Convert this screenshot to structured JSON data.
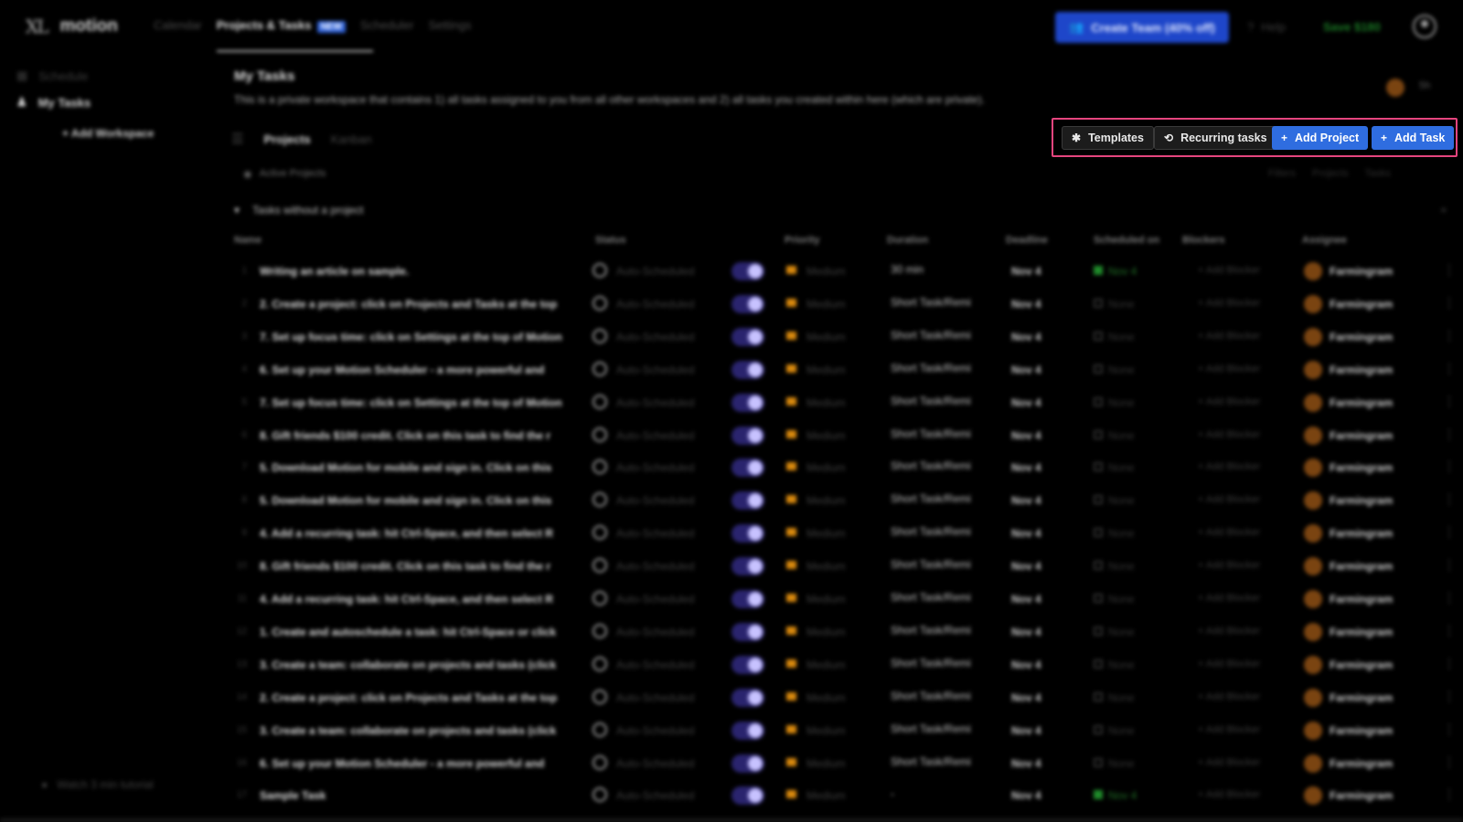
{
  "app": {
    "logo_mark": "XL",
    "name": "motion"
  },
  "topnav": {
    "items": [
      "Calendar",
      "Projects & Tasks",
      "Scheduler",
      "Settings"
    ],
    "new_badge": "NEW",
    "create_team": "Create Team (40% off)",
    "help": "Help",
    "save": "Save $180"
  },
  "sidebar": {
    "schedule": "Schedule",
    "my_tasks": "My Tasks",
    "add_workspace": "+ Add Workspace",
    "tutorial": "Watch 3 min tutorial"
  },
  "page": {
    "title": "My Tasks",
    "description": "This is a private workspace that contains 1) all tasks assigned to you from all other workspaces and 2) all tasks you created within here (which are private).",
    "header_more": "5h"
  },
  "view_tabs": [
    "Projects",
    "Kanban"
  ],
  "toolbar": {
    "templates": "Templates",
    "recurring": "Recurring tasks",
    "add_project": "Add Project",
    "add_task": "Add Task"
  },
  "filters": {
    "active_projects": "Active Projects",
    "filters": "Filters",
    "projects": "Projects",
    "tasks": "Tasks"
  },
  "group": {
    "label": "Tasks without a project"
  },
  "columns": {
    "name": "Name",
    "status": "Status",
    "priority": "Priority",
    "duration": "Duration",
    "deadline": "Deadline",
    "scheduled_on": "Scheduled on",
    "blockers": "Blockers",
    "assignee": "Assignee"
  },
  "rows": [
    {
      "num": "1",
      "name": "Writing an article on sample.",
      "status": "Auto-Scheduled",
      "priority": "Medium",
      "duration": "30 min",
      "deadline": "Nov 4",
      "scheduled": "Nov 4",
      "sched_green": true,
      "blocker": "+ Add Blocker",
      "assignee": "Farmingram"
    },
    {
      "num": "2",
      "name": "2. Create a project: click on Projects and Tasks at the top",
      "status": "Auto-Scheduled",
      "priority": "Medium",
      "duration": "Short Task/Remi",
      "deadline": "Nov 4",
      "scheduled": "None",
      "sched_green": false,
      "blocker": "+ Add Blocker",
      "assignee": "Farmingram"
    },
    {
      "num": "3",
      "name": "7. Set up focus time: click on Settings at the top of Motion",
      "status": "Auto-Scheduled",
      "priority": "Medium",
      "duration": "Short Task/Remi",
      "deadline": "Nov 4",
      "scheduled": "None",
      "sched_green": false,
      "blocker": "+ Add Blocker",
      "assignee": "Farmingram"
    },
    {
      "num": "4",
      "name": "6. Set up your Motion Scheduler - a more powerful and",
      "status": "Auto-Scheduled",
      "priority": "Medium",
      "duration": "Short Task/Remi",
      "deadline": "Nov 4",
      "scheduled": "None",
      "sched_green": false,
      "blocker": "+ Add Blocker",
      "assignee": "Farmingram"
    },
    {
      "num": "5",
      "name": "7. Set up focus time: click on Settings at the top of Motion",
      "status": "Auto-Scheduled",
      "priority": "Medium",
      "duration": "Short Task/Remi",
      "deadline": "Nov 4",
      "scheduled": "None",
      "sched_green": false,
      "blocker": "+ Add Blocker",
      "assignee": "Farmingram"
    },
    {
      "num": "6",
      "name": "8. Gift friends $100 credit. Click on this task to find the r",
      "status": "Auto-Scheduled",
      "priority": "Medium",
      "duration": "Short Task/Remi",
      "deadline": "Nov 4",
      "scheduled": "None",
      "sched_green": false,
      "blocker": "+ Add Blocker",
      "assignee": "Farmingram"
    },
    {
      "num": "7",
      "name": "5. Download Motion for mobile and sign in. Click on this",
      "status": "Auto-Scheduled",
      "priority": "Medium",
      "duration": "Short Task/Remi",
      "deadline": "Nov 4",
      "scheduled": "None",
      "sched_green": false,
      "blocker": "+ Add Blocker",
      "assignee": "Farmingram"
    },
    {
      "num": "8",
      "name": "5. Download Motion for mobile and sign in. Click on this",
      "status": "Auto-Scheduled",
      "priority": "Medium",
      "duration": "Short Task/Remi",
      "deadline": "Nov 4",
      "scheduled": "None",
      "sched_green": false,
      "blocker": "+ Add Blocker",
      "assignee": "Farmingram"
    },
    {
      "num": "9",
      "name": "4. Add a recurring task: hit Ctrl-Space, and then select R",
      "status": "Auto-Scheduled",
      "priority": "Medium",
      "duration": "Short Task/Remi",
      "deadline": "Nov 4",
      "scheduled": "None",
      "sched_green": false,
      "blocker": "+ Add Blocker",
      "assignee": "Farmingram"
    },
    {
      "num": "10",
      "name": "8. Gift friends $100 credit. Click on this task to find the r",
      "status": "Auto-Scheduled",
      "priority": "Medium",
      "duration": "Short Task/Remi",
      "deadline": "Nov 4",
      "scheduled": "None",
      "sched_green": false,
      "blocker": "+ Add Blocker",
      "assignee": "Farmingram"
    },
    {
      "num": "11",
      "name": "4. Add a recurring task: hit Ctrl-Space, and then select R",
      "status": "Auto-Scheduled",
      "priority": "Medium",
      "duration": "Short Task/Remi",
      "deadline": "Nov 4",
      "scheduled": "None",
      "sched_green": false,
      "blocker": "+ Add Blocker",
      "assignee": "Farmingram"
    },
    {
      "num": "12",
      "name": "1. Create and autoschedule a task: hit Ctrl-Space or click",
      "status": "Auto-Scheduled",
      "priority": "Medium",
      "duration": "Short Task/Remi",
      "deadline": "Nov 4",
      "scheduled": "None",
      "sched_green": false,
      "blocker": "+ Add Blocker",
      "assignee": "Farmingram"
    },
    {
      "num": "13",
      "name": "3. Create a team: collaborate on projects and tasks (click",
      "status": "Auto-Scheduled",
      "priority": "Medium",
      "duration": "Short Task/Remi",
      "deadline": "Nov 4",
      "scheduled": "None",
      "sched_green": false,
      "blocker": "+ Add Blocker",
      "assignee": "Farmingram"
    },
    {
      "num": "14",
      "name": "2. Create a project: click on Projects and Tasks at the top",
      "status": "Auto-Scheduled",
      "priority": "Medium",
      "duration": "Short Task/Remi",
      "deadline": "Nov 4",
      "scheduled": "None",
      "sched_green": false,
      "blocker": "+ Add Blocker",
      "assignee": "Farmingram"
    },
    {
      "num": "15",
      "name": "3. Create a team: collaborate on projects and tasks (click",
      "status": "Auto-Scheduled",
      "priority": "Medium",
      "duration": "Short Task/Remi",
      "deadline": "Nov 4",
      "scheduled": "None",
      "sched_green": false,
      "blocker": "+ Add Blocker",
      "assignee": "Farmingram"
    },
    {
      "num": "16",
      "name": "6. Set up your Motion Scheduler - a more powerful and",
      "status": "Auto-Scheduled",
      "priority": "Medium",
      "duration": "Short Task/Remi",
      "deadline": "Nov 4",
      "scheduled": "None",
      "sched_green": false,
      "blocker": "+ Add Blocker",
      "assignee": "Farmingram"
    },
    {
      "num": "17",
      "name": "Sample Task",
      "status": "Auto-Scheduled",
      "priority": "Medium",
      "duration": "-",
      "deadline": "Nov 4",
      "scheduled": "Nov 4",
      "sched_green": true,
      "blocker": "+ Add Blocker",
      "assignee": "Farmingram"
    }
  ]
}
